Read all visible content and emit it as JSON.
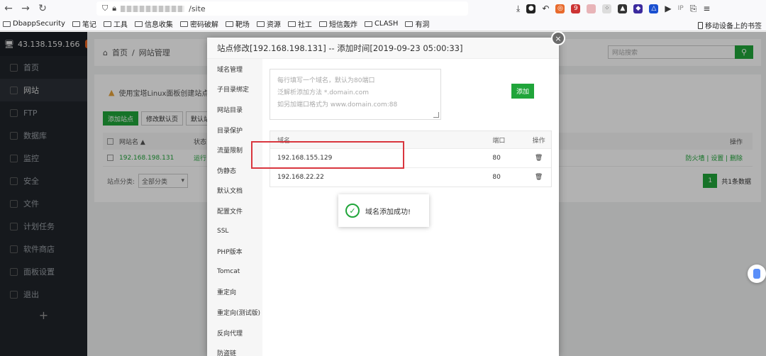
{
  "browser": {
    "url": "/site",
    "bookmarks": [
      "DbappSecurity",
      "笔记",
      "工具",
      "信息收集",
      "密码破解",
      "靶场",
      "资源",
      "社工",
      "短信轰炸",
      "CLASH",
      "有洞"
    ],
    "bookmark_right": "移动设备上的书签",
    "ext_badge": "9",
    "ext_ip": "IP"
  },
  "sidebar": {
    "server": "43.138.159.166",
    "badge": "0",
    "items": [
      {
        "label": "首页"
      },
      {
        "label": "网站"
      },
      {
        "label": "FTP"
      },
      {
        "label": "数据库"
      },
      {
        "label": "监控"
      },
      {
        "label": "安全"
      },
      {
        "label": "文件"
      },
      {
        "label": "计划任务"
      },
      {
        "label": "软件商店"
      },
      {
        "label": "面板设置"
      },
      {
        "label": "退出"
      }
    ],
    "plus": "+"
  },
  "main": {
    "crumb_home": "首页",
    "crumb_sep": "/",
    "crumb_current": "网站管理",
    "search_placeholder": "网站搜索",
    "warning": "使用宝塔Linux面板创建站点时会",
    "buttons": [
      "添加站点",
      "修改默认页",
      "默认站"
    ],
    "col_name": "网站名 ▲",
    "col_status": "状态",
    "col_action": "操作",
    "row_site": "192.168.198.131",
    "row_status": "运行",
    "row_actions": "防火墙 | 设置 | 删除",
    "filter_label": "站点分类:",
    "filter_value": "全部分类",
    "page_num": "1",
    "page_total": "共1条数据"
  },
  "modal": {
    "title": "站点修改[192.168.198.131] -- 添加时间[2019-09-23 05:00:33]",
    "close": "×",
    "nav": [
      "域名管理",
      "子目录绑定",
      "网站目录",
      "目录保护",
      "流量限制",
      "伪静态",
      "默认文档",
      "配置文件",
      "SSL",
      "PHP版本",
      "Tomcat",
      "重定向",
      "重定向(测试版)",
      "反向代理",
      "防盗链"
    ],
    "placeholder_lines": [
      "每行填写一个域名，默认为80端口",
      "泛解析添加方法 *.domain.com",
      "如另加端口格式为 www.domain.com:88"
    ],
    "add_button": "添加",
    "table_headers": {
      "domain": "域名",
      "port": "端口",
      "action": "操作"
    },
    "rows": [
      {
        "domain": "192.168.155.129",
        "port": "80"
      },
      {
        "domain": "192.168.22.22",
        "port": "80"
      }
    ]
  },
  "toast": {
    "message": "域名添加成功!"
  }
}
